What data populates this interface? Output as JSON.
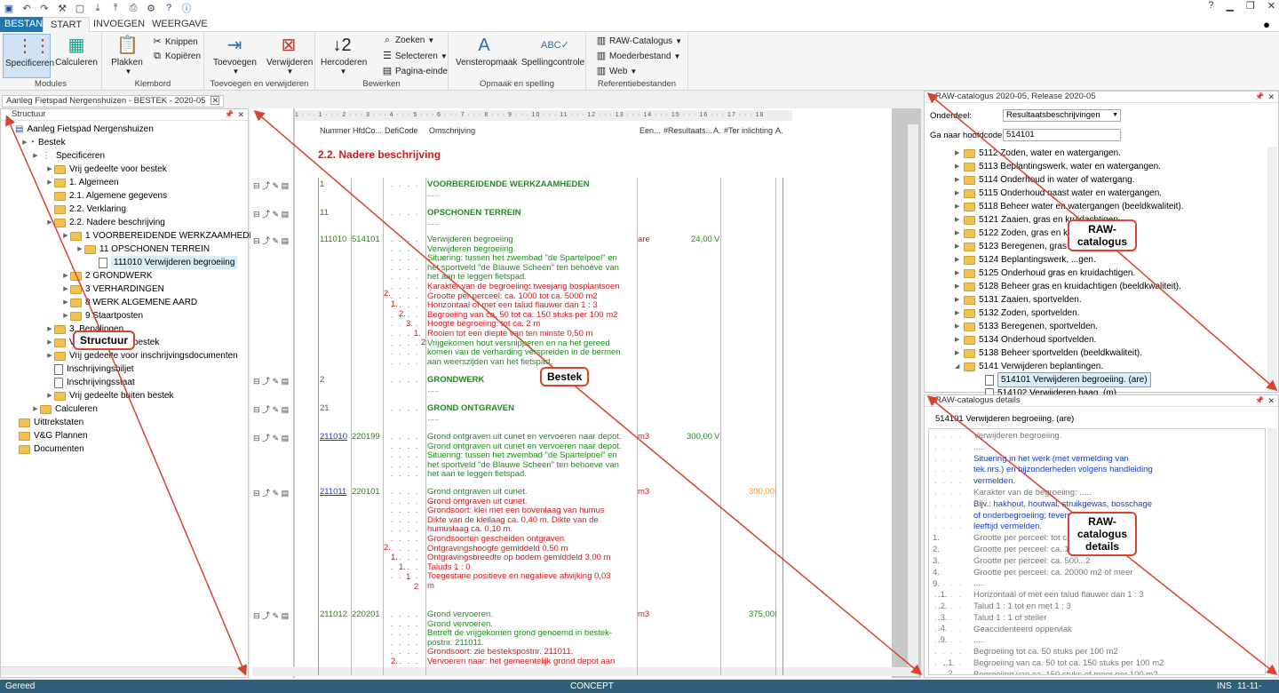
{
  "ribbon": {
    "tabs": {
      "file": "BESTAND",
      "start": "START",
      "insert": "INVOEGEN",
      "view": "WEERGAVE"
    },
    "buttons": {
      "specify": "Specificeren",
      "calculate": "Calculeren",
      "paste": "Plakken",
      "cut": "Knippen",
      "copy": "Kopiëren",
      "add": "Toevoegen",
      "remove": "Verwijderen",
      "recode": "Hercoderen",
      "search": "Zoeken",
      "select": "Selecteren",
      "pagebreak": "Pagina-einde",
      "window_layout": "Vensteropmaak",
      "spellcheck": "Spellingcontrole",
      "raw_catalog": "RAW-Catalogus",
      "parent_file": "Moederbestand",
      "web": "Web"
    },
    "groups": {
      "modules": "Modules",
      "clipboard": "Klembord",
      "add_remove": "Toevoegen en verwijderen",
      "edit": "Bewerken",
      "layout_spelling": "Opmaak en spelling",
      "ref_files": "Referentiebestanden"
    }
  },
  "doc_tab": "Aanleg Fietspad Nergenshuizen - BESTEK - 2020-05",
  "structure": {
    "title": "Structuur",
    "nodes": [
      "Aanleg Fietspad Nergenshuizen",
      "Bestek",
      "Specificeren",
      "Vrij gedeelte voor bestek",
      "1. Algemeen",
      "2.1. Algemene gegevens",
      "2.2. Verklaring",
      "2.2. Nadere beschrijving",
      "1  VOORBEREIDENDE WERKZAAMHEDEN",
      "11  OPSCHONEN TERREIN",
      "111010  Verwijderen begroeiing",
      "2  GRONDWERK",
      "3  VERHARDINGEN",
      "8  WERK ALGEMENE AARD",
      "9  Staartposten",
      "3. Bepalingen",
      "Vrij gedeelte na bestek",
      "Vrij gedeelte voor inschrijvingsdocumenten",
      "Inschrijvingsbiljet",
      "Inschrijvingsstaat",
      "Vrij gedeelte buiten bestek",
      "Calculeren",
      "Uittrekstaten",
      "V&G Plannen",
      "Documenten"
    ]
  },
  "editor": {
    "ruler": "1 · · · 1 · · · 2 · · · 3 · · · 4 · · · 5 · · · 6 · · · 7 · · · 8 · · · 9 · · · 10 · · · 11 · · · 12 · · · 13 · · · 14 · · · 15 · · · 16 · · · 17 · · · 18",
    "columns": {
      "nummer": "Nummer",
      "hfdco": "HfdCo...",
      "deficode": "DefiCode",
      "omschrijving": "Omschrijving",
      "een": "Een...",
      "resultaat": "#Resultaats...",
      "a1": "A.",
      "ter": "#Ter inlichting",
      "a2": "A."
    },
    "section_title": "2.2. Nadere beschrijving",
    "rows": {
      "r1": {
        "num": "1",
        "text": "VOORBEREIDENDE WERKZAAMHEDEN"
      },
      "r11": {
        "num": "11",
        "text": "OPSCHONEN TERREIN"
      },
      "r111010": {
        "num": "111010",
        "hfd": "514101",
        "unit": "are",
        "qty": "24,00",
        "flag": "V",
        "lines": [
          "Verwijderen begroeiing",
          "Verwijderen begroeiing.",
          "Situering: tussen het zwembad \"de Spartelpoel\" en",
          "het sportveld \"de Blauwe Scheen\" ten behoeve van",
          "het aan te leggen fietspad.",
          "Karakter van de begroeiing: tweejarig bosplantsoen",
          "Grootte per perceel: ca. 1000 tot ca. 5000 m2",
          "Horizontaal of met een talud flauwer dan 1 : 3",
          "Begroeiing van ca. 50 tot ca. 150 stuks per 100 m2",
          "Hoogte begroeiing: tot ca. 2 m",
          "Rooien tot een diepte van ten minste 0,50 m",
          "Vrijgekomen hout versnipperen en na het gereed",
          "komen van de verharding verspreiden in de bermen",
          "aan weerszijden van het fietspad."
        ],
        "codes": [
          "2.",
          "1.",
          "2.",
          "3.",
          "1.",
          "2"
        ]
      },
      "r2": {
        "num": "2",
        "text": "GRONDWERK"
      },
      "r21": {
        "num": "21",
        "text": "GROND ONTGRAVEN"
      },
      "r211010": {
        "num": "211010",
        "hfd": "220199",
        "unit": "m3",
        "qty": "300,00",
        "flag": "V",
        "lines": [
          "Grond ontgraven uit cunet en vervoeren naar depot.",
          "Grond ontgraven uit cunet en vervoeren naar depot.",
          "Situering: tussen het zwembad \"de Spartelpoel\" en",
          "het sportveld \"de Blauwe Scheen\" ten behoeve van",
          "het aan te leggen fietspad."
        ]
      },
      "r211011": {
        "num": "211011",
        "hfd": "220101",
        "unit": "m3",
        "qty": "300,00",
        "flag": "I",
        "lines": [
          "Grond ontgraven uit cunet.",
          "Grond ontgraven uit cunet.",
          "Grondsoort: klei met een bovenlaag van humus",
          "Dikte van de kleilaag ca. 0,40 m. Dikte van de",
          "humuslaag ca. 0,10 m.",
          "Grondsoorten gescheiden ontgraven",
          "Ontgravingshoogte gemiddeld 0,50 m",
          "Ontgravingsbreedte op bodem gemiddeld 3,00 m",
          "Taluds 1 : 0",
          "Toegestane positieve en negatieve afwijking 0,03",
          "m"
        ],
        "codes": [
          "2.",
          "1.",
          "1.",
          "1",
          "2"
        ]
      },
      "r211012": {
        "num": "211012",
        "hfd": "220201",
        "unit": "m3",
        "qty": "375,00",
        "flag": "I",
        "lines": [
          "Grond vervoeren.",
          "Grond vervoeren.",
          "Betreft de vrijgekomen grond genoemd in bestek-",
          "postnr. 211011.",
          "Grondsoort:  zie bestekspostnr. 211011.",
          "Vervoeren naar: het gemeentelijk grond depot aan"
        ],
        "codes": [
          "2."
        ]
      }
    }
  },
  "catalog": {
    "title": "RAW-catalogus 2020-05, Release 2020-05",
    "onderdeel_label": "Onderdeel:",
    "onderdeel_value": "Resultaatsbeschrijvingen",
    "goto_label": "Ga naar hoofdcode:",
    "goto_value": "514101",
    "items": [
      "5112  Zoden, water en watergangen.",
      "5113  Beplantingswerk, water en watergangen.",
      "5114  Onderhoud in water of watergang.",
      "5115  Onderhoud naast water en watergangen.",
      "5118  Beheer water en watergangen (beeldkwaliteit).",
      "5121  Zaaien, gras en kruidachtigen.",
      "5122  Zoden, gras en kr...",
      "5123  Beregenen, gras ...",
      "5124  Beplantingswerk, ...gen.",
      "5125  Onderhoud gras en kruidachtigen.",
      "5128  Beheer gras en kruidachtigen (beeldkwaliteit).",
      "5131  Zaaien, sportvelden.",
      "5132  Zoden, sportvelden.",
      "5133  Beregenen, sportvelden.",
      "5134  Onderhoud sportvelden.",
      "5138  Beheer sportvelden (beeldkwaliteit).",
      "5141  Verwijderen beplantingen.",
      "514101  Verwijderen begroeiing. (are)",
      "514102  Verwijderen haag. (m)"
    ]
  },
  "details": {
    "title": "RAW-catalogus details",
    "header": "514101   Verwijderen begroeiing. (are)",
    "lines": [
      "Verwijderen begroeiing.",
      ".....",
      "Situering in het werk (met vermelding van",
      "tek.nrs.) en bijzonderheden volgens handleiding",
      "vermelden.",
      "Karakter van de begroeiing: .....",
      "Bijv.: hakhout, houtwal, struikgewas, bosschage",
      "of onderbegroeiing; tevens ...",
      "leeftijd vermelden.",
      "Grootte per perceel: tot ca. ...",
      "Grootte per perceel: ca. 10...",
      "Grootte per perceel: ca. 500...2",
      "Grootte per perceel: ca. 20000 m2 of meer",
      ".....",
      "Horizontaal of met een talud flauwer dan 1 : 3",
      "Talud 1 : 1 tot en met 1 : 3",
      "Talud 1 : 1 of steiler",
      "Geaccidenteerd oppervlak",
      ".....",
      "Begroeiing tot ca. 50 stuks per 100 m2",
      "Begroeiing van ca. 50 tot ca. 150 stuks per 100 m2",
      "Begroeiing van ca. 150 stuks of meer per 100 m2"
    ],
    "codes": [
      "1.",
      "2.",
      "3.",
      "4.",
      "9.",
      ".1.",
      ".2.",
      ".3.",
      ".4.",
      ".9.",
      "..1.",
      "..2.",
      "..3."
    ]
  },
  "callouts": {
    "structuur": "Structuur",
    "bestek": "Bestek",
    "raw": "RAW-catalogus",
    "rawdet": "RAW-catalogus details"
  },
  "status": {
    "left": "Gereed",
    "center": "CONCEPT",
    "ins": "INS",
    "date": "11-11-2021"
  },
  "colors": {
    "accent": "#1f77b4",
    "callout": "#d9432f",
    "status_bg": "#2f5f7a",
    "green": "#1e8c1e",
    "red": "#d0191b"
  }
}
